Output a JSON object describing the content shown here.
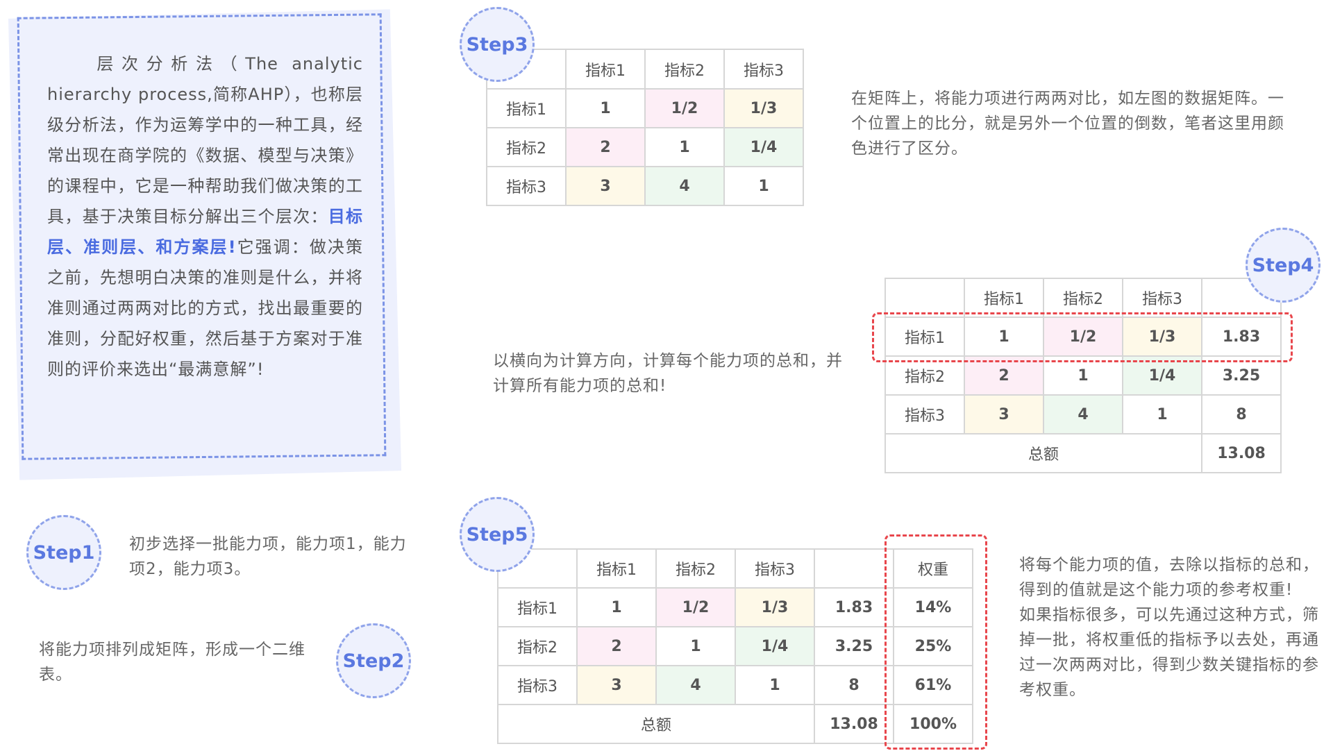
{
  "intro": {
    "part1": "层次分析法（The analytic hierarchy process,简称AHP），也称层级分析法，作为运筹学中的一种工具，经常出现在商学院的《数据、模型与决策》的课程中，它是一种帮助我们做决策的工具，基于决策目标分解出三个层次：",
    "highlight": "目标层、准则层、和方案层!",
    "part2": "它强调：做决策之前，先想明白决策的准则是什么，并将准则通过两两对比的方式，找出最重要的准则，分配好权重，然后基于方案对于准则的评价来选出“最满意解”!"
  },
  "steps": {
    "s1": "Step1",
    "s2": "Step2",
    "s3": "Step3",
    "s4": "Step4",
    "s5": "Step5"
  },
  "texts": {
    "step1": "初步选择一批能力项，能力项1，能力项2，能力项3。",
    "step2": "将能力项排列成矩阵，形成一个二维表。",
    "step3": "在矩阵上，将能力项进行两两对比，如左图的数据矩阵。一个位置上的比分，就是另外一个位置的倒数，笔者这里用颜色进行了区分。",
    "step4": "以横向为计算方向，计算每个能力项的总和，并计算所有能力项的总和!",
    "step5a": "将每个能力项的值，去除以指标的总和，得到的值就是这个能力项的参考权重!",
    "step5b": "如果指标很多，可以先通过这种方式，筛掉一批，将权重低的指标予以去处，再通过一次两两对比，得到少数关键指标的参考权重。"
  },
  "table": {
    "headers": [
      "指标1",
      "指标2",
      "指标3"
    ],
    "rows": [
      {
        "label": "指标1",
        "c1": "1",
        "c2": "1/2",
        "c3": "1/3",
        "sum": "1.83",
        "weight": "14%"
      },
      {
        "label": "指标2",
        "c1": "2",
        "c2": "1",
        "c3": "1/4",
        "sum": "3.25",
        "weight": "25%"
      },
      {
        "label": "指标3",
        "c1": "3",
        "c2": "4",
        "c3": "1",
        "sum": "8",
        "weight": "61%"
      }
    ],
    "total_label": "总额",
    "total": "13.08",
    "weight_header": "权重",
    "weight_total": "100%"
  },
  "colors": {
    "accent": "#5a78e0",
    "pink": "#e274b4",
    "yellow": "#f1b52c",
    "green": "#5dc077",
    "red_dash": "#e8464c"
  }
}
